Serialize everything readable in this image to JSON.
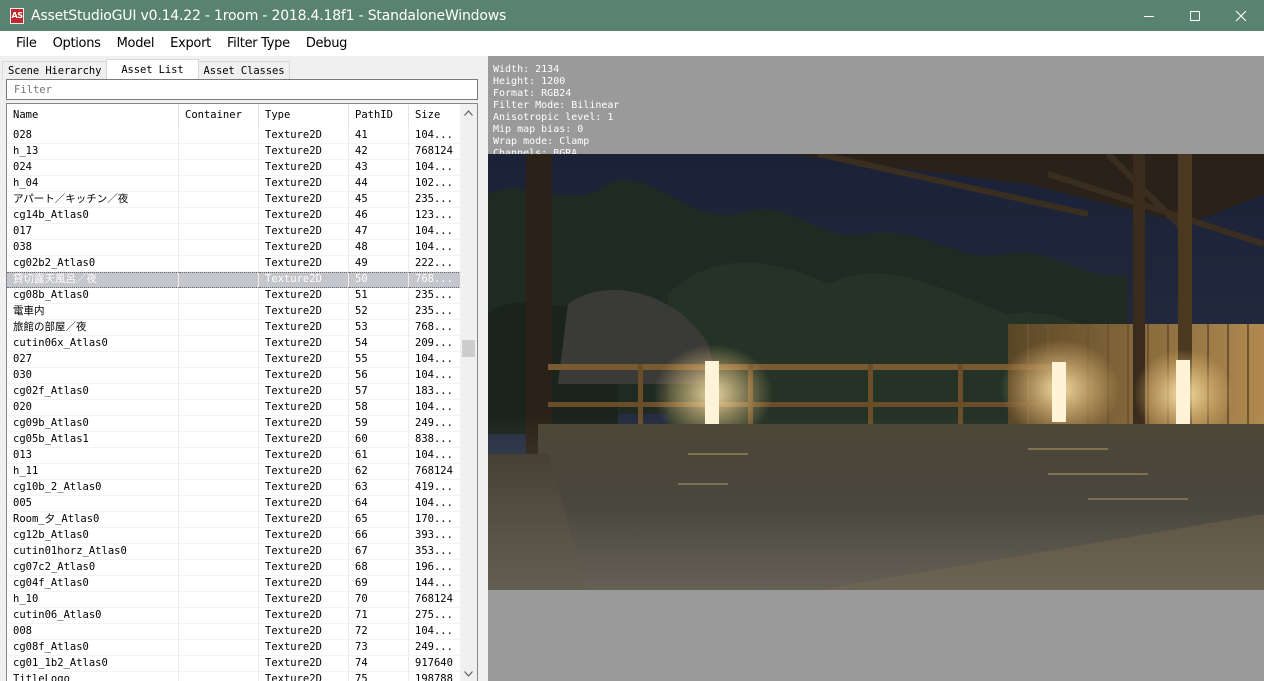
{
  "window": {
    "icon_text": "AS",
    "title": "AssetStudioGUI v0.14.22 - 1room - 2018.4.18f1 - StandaloneWindows"
  },
  "menu": [
    "File",
    "Options",
    "Model",
    "Export",
    "Filter Type",
    "Debug"
  ],
  "tabs": [
    "Scene Hierarchy",
    "Asset List",
    "Asset Classes"
  ],
  "active_tab": "Asset List",
  "filter": {
    "placeholder": "Filter",
    "value": ""
  },
  "columns": [
    "Name",
    "Container",
    "Type",
    "PathID",
    "Size"
  ],
  "rows": [
    {
      "name": "028",
      "container": "",
      "type": "Texture2D",
      "path_id": "41",
      "size": "104..."
    },
    {
      "name": "h_13",
      "container": "",
      "type": "Texture2D",
      "path_id": "42",
      "size": "768124"
    },
    {
      "name": "024",
      "container": "",
      "type": "Texture2D",
      "path_id": "43",
      "size": "104..."
    },
    {
      "name": "h_04",
      "container": "",
      "type": "Texture2D",
      "path_id": "44",
      "size": "102..."
    },
    {
      "name": "アパート／キッチン／夜",
      "container": "",
      "type": "Texture2D",
      "path_id": "45",
      "size": "235..."
    },
    {
      "name": "cg14b_Atlas0",
      "container": "",
      "type": "Texture2D",
      "path_id": "46",
      "size": "123..."
    },
    {
      "name": "017",
      "container": "",
      "type": "Texture2D",
      "path_id": "47",
      "size": "104..."
    },
    {
      "name": "038",
      "container": "",
      "type": "Texture2D",
      "path_id": "48",
      "size": "104..."
    },
    {
      "name": "cg02b2_Atlas0",
      "container": "",
      "type": "Texture2D",
      "path_id": "49",
      "size": "222..."
    },
    {
      "name": "貸切露天風呂／夜",
      "container": "",
      "type": "Texture2D",
      "path_id": "50",
      "size": "768...",
      "selected": true
    },
    {
      "name": "cg08b_Atlas0",
      "container": "",
      "type": "Texture2D",
      "path_id": "51",
      "size": "235..."
    },
    {
      "name": "電車内",
      "container": "",
      "type": "Texture2D",
      "path_id": "52",
      "size": "235..."
    },
    {
      "name": "旅館の部屋／夜",
      "container": "",
      "type": "Texture2D",
      "path_id": "53",
      "size": "768..."
    },
    {
      "name": "cutin06x_Atlas0",
      "container": "",
      "type": "Texture2D",
      "path_id": "54",
      "size": "209..."
    },
    {
      "name": "027",
      "container": "",
      "type": "Texture2D",
      "path_id": "55",
      "size": "104..."
    },
    {
      "name": "030",
      "container": "",
      "type": "Texture2D",
      "path_id": "56",
      "size": "104..."
    },
    {
      "name": "cg02f_Atlas0",
      "container": "",
      "type": "Texture2D",
      "path_id": "57",
      "size": "183..."
    },
    {
      "name": "020",
      "container": "",
      "type": "Texture2D",
      "path_id": "58",
      "size": "104..."
    },
    {
      "name": "cg09b_Atlas0",
      "container": "",
      "type": "Texture2D",
      "path_id": "59",
      "size": "249..."
    },
    {
      "name": "cg05b_Atlas1",
      "container": "",
      "type": "Texture2D",
      "path_id": "60",
      "size": "838..."
    },
    {
      "name": "013",
      "container": "",
      "type": "Texture2D",
      "path_id": "61",
      "size": "104..."
    },
    {
      "name": "h_11",
      "container": "",
      "type": "Texture2D",
      "path_id": "62",
      "size": "768124"
    },
    {
      "name": "cg10b_2_Atlas0",
      "container": "",
      "type": "Texture2D",
      "path_id": "63",
      "size": "419..."
    },
    {
      "name": "005",
      "container": "",
      "type": "Texture2D",
      "path_id": "64",
      "size": "104..."
    },
    {
      "name": "Room_夕_Atlas0",
      "container": "",
      "type": "Texture2D",
      "path_id": "65",
      "size": "170..."
    },
    {
      "name": "cg12b_Atlas0",
      "container": "",
      "type": "Texture2D",
      "path_id": "66",
      "size": "393..."
    },
    {
      "name": "cutin01horz_Atlas0",
      "container": "",
      "type": "Texture2D",
      "path_id": "67",
      "size": "353..."
    },
    {
      "name": "cg07c2_Atlas0",
      "container": "",
      "type": "Texture2D",
      "path_id": "68",
      "size": "196..."
    },
    {
      "name": "cg04f_Atlas0",
      "container": "",
      "type": "Texture2D",
      "path_id": "69",
      "size": "144..."
    },
    {
      "name": "h_10",
      "container": "",
      "type": "Texture2D",
      "path_id": "70",
      "size": "768124"
    },
    {
      "name": "cutin06_Atlas0",
      "container": "",
      "type": "Texture2D",
      "path_id": "71",
      "size": "275..."
    },
    {
      "name": "008",
      "container": "",
      "type": "Texture2D",
      "path_id": "72",
      "size": "104..."
    },
    {
      "name": "cg08f_Atlas0",
      "container": "",
      "type": "Texture2D",
      "path_id": "73",
      "size": "249..."
    },
    {
      "name": "cg01_1b2_Atlas0",
      "container": "",
      "type": "Texture2D",
      "path_id": "74",
      "size": "917640"
    },
    {
      "name": "TitleLogo",
      "container": "",
      "type": "Texture2D",
      "path_id": "75",
      "size": "198788"
    }
  ],
  "texture_info": [
    "Width: 2134",
    "Height: 1200",
    "Format: RGB24",
    "Filter Mode: Bilinear",
    "Anisotropic level: 1",
    "Mip map bias: 0",
    "Wrap mode: Clamp",
    "Channels: BGRA"
  ],
  "preview": {
    "subject": "open-air-bath-night-image"
  },
  "colors": {
    "titlebar": "#5a8270",
    "selected_row": "#c4c6cc",
    "preview_bg": "#9a9a9a"
  }
}
